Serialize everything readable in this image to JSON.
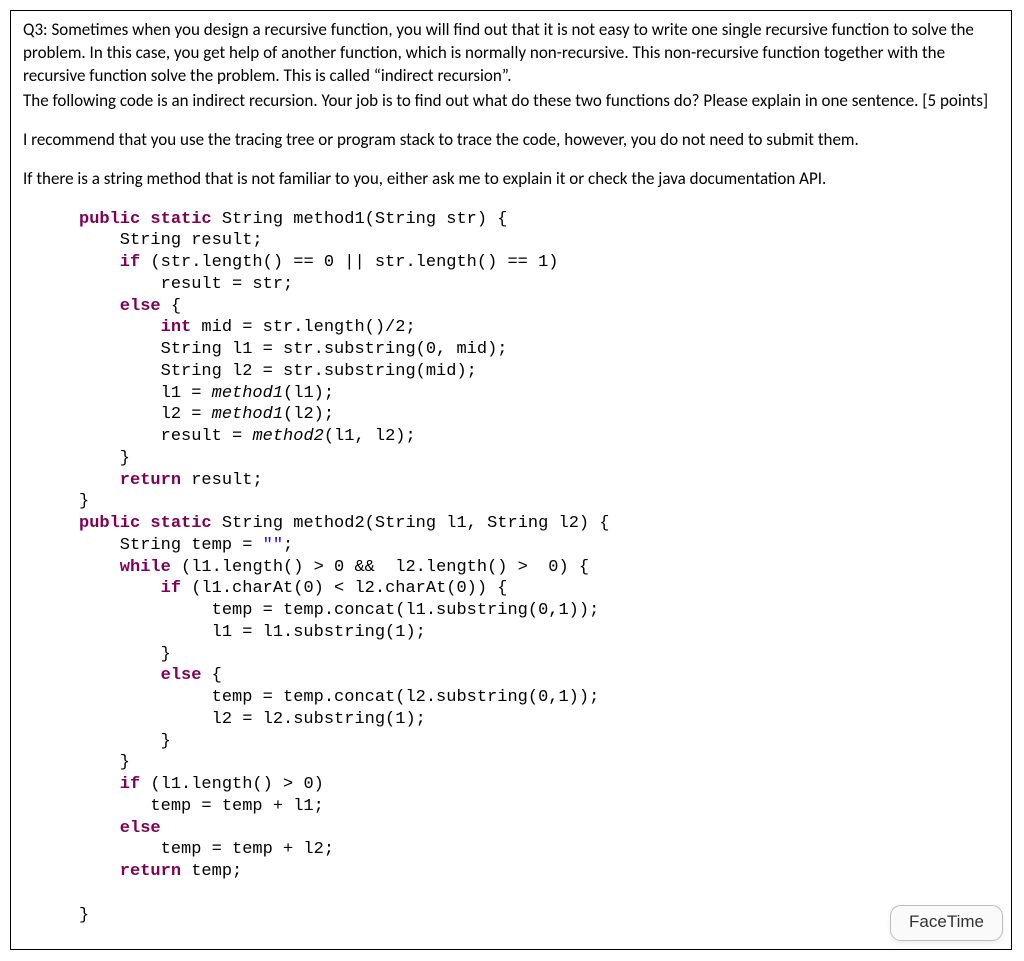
{
  "question": {
    "para1": "Q3: Sometimes when you design a recursive function, you will find out that it is not easy to write one single recursive function to solve the problem. In this case, you get help of another function, which is normally non-recursive. This non-recursive function together with the recursive function solve the problem. This is called “indirect recursion”.",
    "para2": "The following code is an indirect recursion. Your job is to find out what do these two functions do? Please explain in one sentence. [5 points]",
    "para3": "I recommend that you use the tracing tree or program stack to trace the code, however, you do not need to submit them.",
    "para4": "If there is a string method that is not familiar to you, either ask me to explain it or check the java documentation API."
  },
  "code": {
    "l1": {
      "kw1": "public",
      "kw2": "static",
      "t1": " String method1(String str) {"
    },
    "l2": {
      "t": "    String result;"
    },
    "l3": {
      "kw1": "    if",
      "t1": " (str.length() == 0 || str.length() == 1)"
    },
    "l4": {
      "t": "        result = str;"
    },
    "l5": {
      "kw1": "    else",
      "t1": " {"
    },
    "l6": {
      "kw1": "        int",
      "t1": " mid = str.length()/2;"
    },
    "l7": {
      "t": "        String l1 = str.substring(0, mid);"
    },
    "l8": {
      "t": "        String l2 = str.substring(mid);"
    },
    "l9": {
      "t1": "        l1 = ",
      "em": "method1",
      "t2": "(l1);"
    },
    "l10": {
      "t1": "        l2 = ",
      "em": "method1",
      "t2": "(l2);"
    },
    "l11": {
      "t1": "        result = ",
      "em": "method2",
      "t2": "(l1, l2);"
    },
    "l12": {
      "t": "    }"
    },
    "l13": {
      "kw1": "    return",
      "t1": " result;"
    },
    "l14": {
      "t": "}"
    },
    "l15": {
      "kw1": "public",
      "kw2": "static",
      "t1": " String method2(String l1, String l2) {"
    },
    "l16": {
      "t1": "    String temp = ",
      "str": "\"\"",
      "t2": ";"
    },
    "l17": {
      "kw1": "    while",
      "t1": " (l1.length() > 0 &&  l2.length() >  0) {"
    },
    "l18": {
      "kw1": "        if",
      "t1": " (l1.charAt(0) < l2.charAt(0)) {"
    },
    "l19": {
      "t": "             temp = temp.concat(l1.substring(0,1));"
    },
    "l20": {
      "t": "             l1 = l1.substring(1);"
    },
    "l21": {
      "t": "        }"
    },
    "l22": {
      "kw1": "        else",
      "t1": " {"
    },
    "l23": {
      "t": "             temp = temp.concat(l2.substring(0,1));"
    },
    "l24": {
      "t": "             l2 = l2.substring(1);"
    },
    "l25": {
      "t": "        }"
    },
    "l26": {
      "t": "    }"
    },
    "l27": {
      "kw1": "    if",
      "t1": " (l1.length() > 0)"
    },
    "l28": {
      "t": "       temp = temp + l1;"
    },
    "l29": {
      "kw1": "    else",
      "t1": ""
    },
    "l30": {
      "t": "        temp = temp + l2;"
    },
    "l31": {
      "kw1": "    return",
      "t1": " temp;"
    },
    "l33": {
      "t": "}"
    }
  },
  "notification": {
    "label": "FaceTime"
  }
}
